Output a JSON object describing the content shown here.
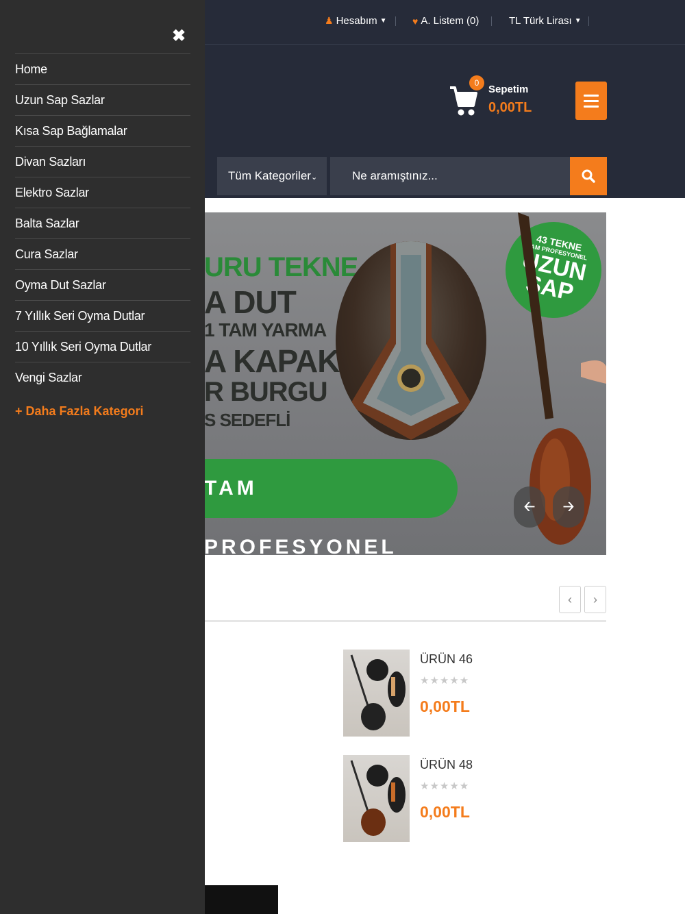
{
  "topbar": {
    "account_label": "Hesabım",
    "wishlist_label": "A. Listem (0)",
    "currency_label": "TL Türk Lirası"
  },
  "cart": {
    "count": "0",
    "title": "Sepetim",
    "total": "0,00TL"
  },
  "search": {
    "category_label": "Tüm Kategoriler",
    "placeholder": "Ne aramıştınız..."
  },
  "banner": {
    "lines": [
      "URU TEKNE",
      "A DUT",
      "1 TAM YARMA",
      "A KAPAK",
      "R BURGU",
      "S SEDEFLİ"
    ],
    "badge_line1": "43 TEKNE",
    "badge_line2": "TAM PROFESYONEL",
    "badge_line3": "UZUN",
    "badge_line4": "SAP",
    "pill_text": "TAM PROFESYONEL",
    "prev_label": "🡠",
    "next_label": "🡢"
  },
  "section": {
    "prev_label": "‹",
    "next_label": "›"
  },
  "products": [
    {
      "name": "ÜRÜN 46",
      "stars": "★★★★★",
      "price": "0,00TL"
    },
    {
      "name": "ÜRÜN 48",
      "stars": "★★★★★",
      "price": "0,00TL"
    }
  ],
  "drawer": {
    "close_label": "✖",
    "items": [
      "Home",
      "Uzun Sap Sazlar",
      "Kısa Sap Bağlamalar",
      "Divan Sazları",
      "Elektro Sazlar",
      "Balta Sazlar",
      "Cura Sazlar",
      "Oyma Dut Sazlar",
      "7 Yıllık Seri Oyma Dutlar",
      "10 Yıllık Seri Oyma Dutlar",
      "Vengi Sazlar"
    ],
    "more_label": "+  Daha Fazla Kategori"
  },
  "colors": {
    "accent": "#f47c1c",
    "header_bg": "#262b39",
    "drawer_bg": "#2e2e2e",
    "banner_green": "#2f9a3f"
  }
}
